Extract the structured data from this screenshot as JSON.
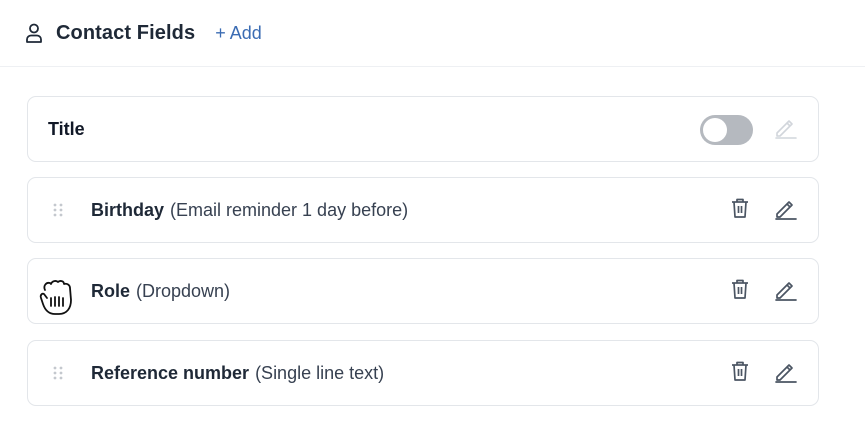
{
  "header": {
    "title": "Contact Fields",
    "add_label": "+ Add"
  },
  "rows": [
    {
      "name": "Title",
      "description": "",
      "toggle_on": false
    },
    {
      "name": "Birthday",
      "description": "(Email reminder 1 day before)"
    },
    {
      "name": "Role",
      "description": "(Dropdown)"
    },
    {
      "name": "Reference number",
      "description": "(Single line text)"
    }
  ],
  "colors": {
    "accent": "#3b6cb3",
    "text": "#1f2937",
    "border": "#e3e6ea",
    "toggle_off": "#b5b9bf"
  },
  "icons": [
    "person-icon",
    "drag-handle-icon",
    "trash-icon",
    "pencil-icon",
    "grab-cursor-icon"
  ]
}
